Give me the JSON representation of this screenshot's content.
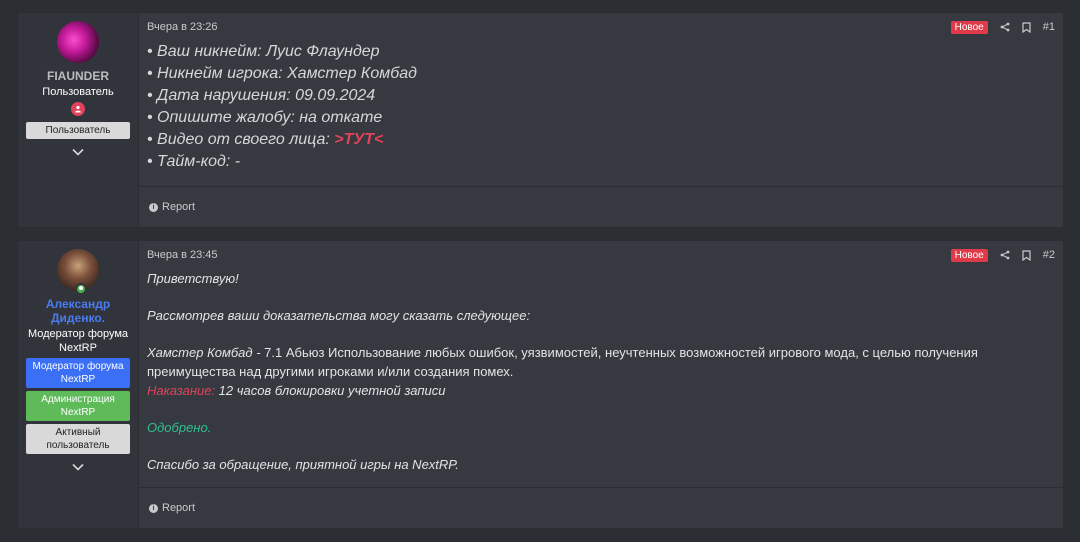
{
  "posts": [
    {
      "user": {
        "name": "FIAUNDER",
        "title": "Пользователь",
        "badges": [
          "Пользователь"
        ]
      },
      "time": "Вчера в 23:26",
      "new_label": "Новое",
      "number": "#1",
      "lines": [
        "• Ваш никнейм: Луис Флаундер",
        "• Никнейм игрока: Хамстер Комбад",
        "• Дата нарушения: 09.09.2024",
        "• Опишите жалобу: на откате",
        "• Видео от своего лица: ",
        "• Тайм-код: -"
      ],
      "video_link": ">ТУТ<",
      "report_label": "Report"
    },
    {
      "user": {
        "name": "Александр Диденко.",
        "title": "Модератор форума NextRP",
        "badges": [
          "Модератор форума NextRP",
          "Администрация NextRP",
          "Активный пользователь"
        ]
      },
      "time": "Вчера в 23:45",
      "new_label": "Новое",
      "number": "#2",
      "greeting": "Приветствую!",
      "intro": "Рассмотрев ваши доказательства могу сказать следующее:",
      "violation_prefix": "Хамстер Комбад - ",
      "violation_text": "7.1 Абьюз Использование любых ошибок, уязвимостей, неучтенных возможностей игрового мода, с целью получения преимущества над другими игроками и/или создания помех.",
      "punishment_label": "Наказание:",
      "punishment_text": " 12 часов блокировки учетной записи",
      "verdict": "Одобрено.",
      "closing": "Спасибо за обращение, приятной игры на NextRP.",
      "report_label": "Report"
    }
  ],
  "colors": {
    "background": "#2b2e33",
    "post_bg": "#363a40",
    "accent_red": "#e0435a",
    "accent_green": "#2fbf8f",
    "mod_blue": "#3b6ff5",
    "admin_green": "#5fba5a"
  }
}
